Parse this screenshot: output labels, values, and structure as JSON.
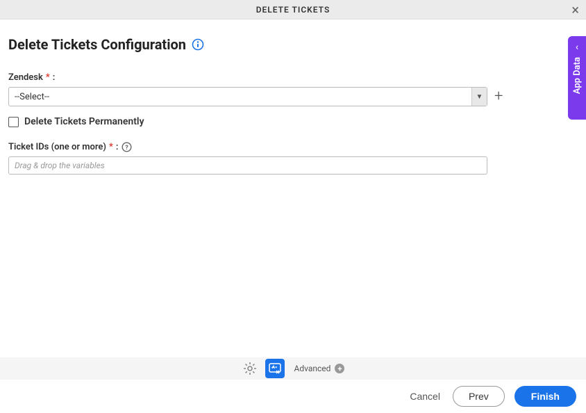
{
  "header": {
    "title": "DELETE TICKETS"
  },
  "page": {
    "title": "Delete Tickets Configuration"
  },
  "form": {
    "zendesk": {
      "label": "Zendesk",
      "required": "*",
      "colon": ":",
      "selected": "--Select--"
    },
    "delete_permanently": {
      "label": "Delete Tickets Permanently",
      "checked": false
    },
    "ticket_ids": {
      "label": "Ticket IDs (one or more)",
      "required": "*",
      "colon": ":",
      "placeholder": "Drag & drop the variables"
    }
  },
  "side_tab": {
    "label": "App Data"
  },
  "toolbar": {
    "advanced_label": "Advanced"
  },
  "footer": {
    "cancel": "Cancel",
    "prev": "Prev",
    "finish": "Finish"
  }
}
